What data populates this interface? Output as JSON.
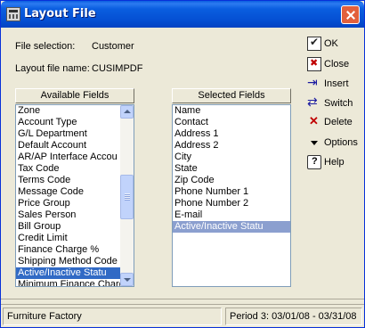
{
  "window": {
    "title": "Layout File",
    "title_icon": "calculator-app-icon",
    "close_icon": "close-icon"
  },
  "info": {
    "file_selection_label": "File selection:",
    "file_selection_value": "Customer",
    "layout_name_label": "Layout file name:",
    "layout_name_value": "CUSIMPDF"
  },
  "available_fields": {
    "header": "Available Fields",
    "items": [
      "Zone",
      "Account Type",
      "G/L Department",
      "Default Account",
      "AR/AP Interface Accou",
      "Tax  Code",
      "Terms Code",
      "Message Code",
      "Price Group",
      "Sales Person",
      "Bill Group",
      "Credit Limit",
      "Finance Charge %",
      "Shipping Method Code",
      "Active/Inactive Statu",
      "Minimum Finance Charg"
    ],
    "selected_item": "Active/Inactive Statu"
  },
  "selected_fields": {
    "header": "Selected Fields",
    "items": [
      "Name",
      "Contact",
      "Address 1",
      "Address 2",
      "City",
      "State",
      "Zip Code",
      "Phone Number 1",
      "Phone Number 2",
      "E-mail",
      "Active/Inactive Statu"
    ],
    "selected_item": "Active/Inactive Statu"
  },
  "commands": {
    "ok": "OK",
    "close": "Close",
    "insert": "Insert",
    "switch": "Switch",
    "delete": "Delete",
    "options": "Options",
    "help": "Help"
  },
  "status": {
    "company": "Furniture Factory",
    "period": "Period  3: 03/01/08 - 03/31/08"
  },
  "colors": {
    "titlebar": "#0a5ee0",
    "selection": "#316ac5",
    "selection_inactive": "#8b9fcf",
    "dialog_bg": "#ece9d8"
  }
}
